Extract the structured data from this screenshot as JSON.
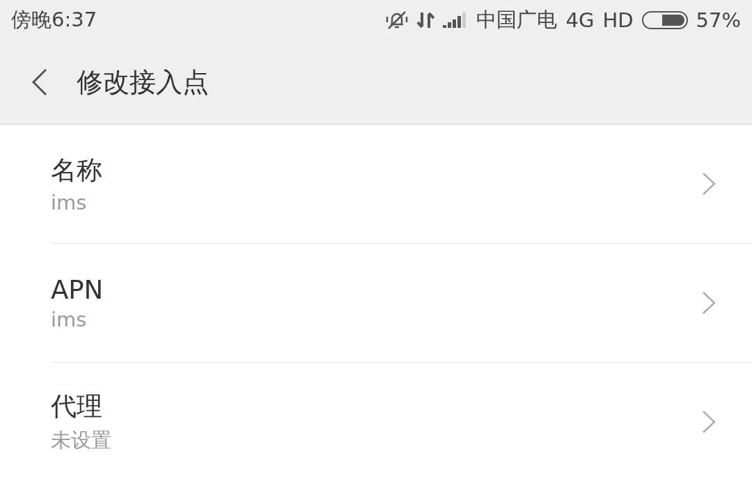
{
  "status_bar": {
    "time": "傍晚6:37",
    "carrier": "中国广电",
    "network": "4G",
    "hd": "HD",
    "battery": "57%"
  },
  "toolbar": {
    "title": "修改接入点"
  },
  "items": [
    {
      "label": "名称",
      "value": "ims"
    },
    {
      "label": "APN",
      "value": "ims"
    },
    {
      "label": "代理",
      "value": "未设置"
    }
  ]
}
